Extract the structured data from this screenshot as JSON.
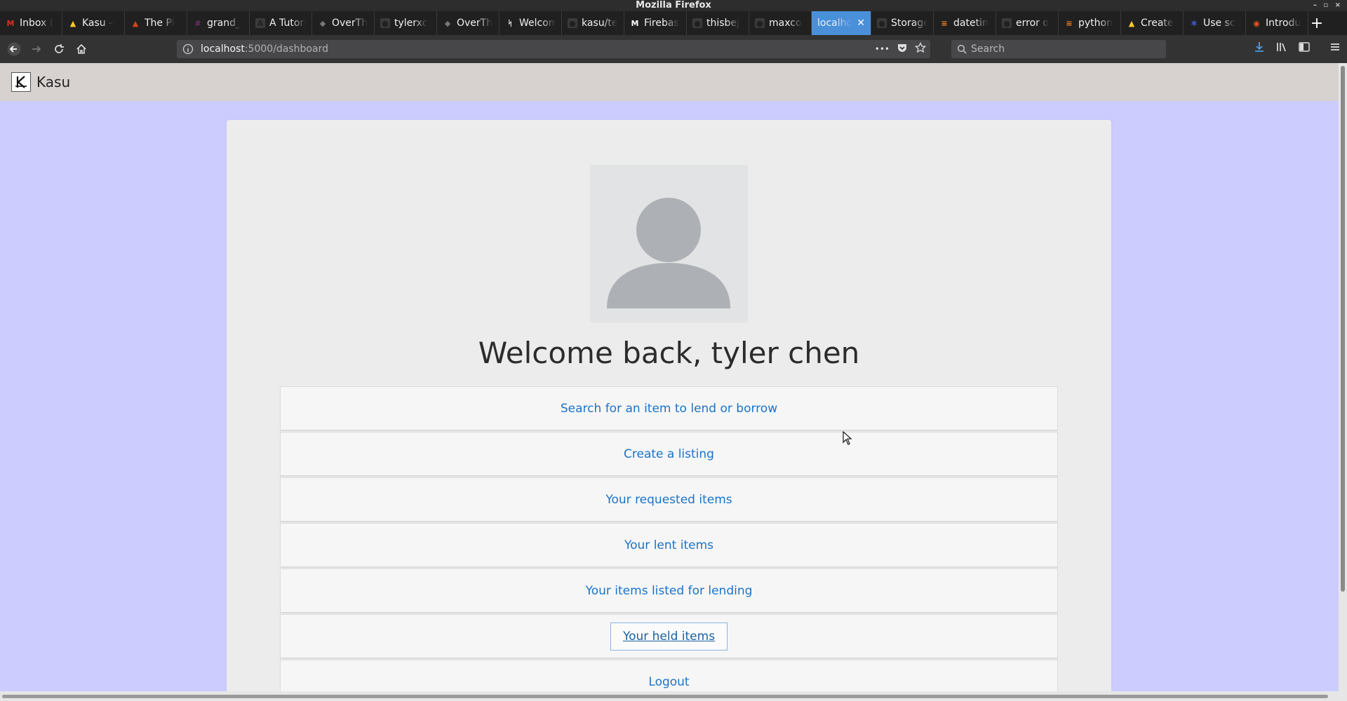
{
  "window": {
    "title": "Mozilla Firefox",
    "controls": "– ▫ ×"
  },
  "tabs": [
    {
      "label": "Inbox (",
      "favicon": "gmail-icon",
      "color": "#d93025"
    },
    {
      "label": "Kasu –",
      "favicon": "firebase-icon",
      "color": "#ffca28"
    },
    {
      "label": "The Pi",
      "favicon": "piedpiper-icon",
      "color": "#d84315"
    },
    {
      "label": "grand_",
      "favicon": "slack-icon",
      "color": "#6f2d6b"
    },
    {
      "label": "A Tutorial",
      "favicon": "text-icon",
      "color": "#202020"
    },
    {
      "label": "OverTh",
      "favicon": "overthewire-icon",
      "color": "#777777"
    },
    {
      "label": "tylerxc",
      "favicon": "github-icon",
      "color": "#202020"
    },
    {
      "label": "OverTh",
      "favicon": "overthewire-icon",
      "color": "#777777"
    },
    {
      "label": "Welcom",
      "favicon": "kasu-icon",
      "color": "#ffffff"
    },
    {
      "label": "kasu/te",
      "favicon": "github-icon",
      "color": "#202020"
    },
    {
      "label": "Firebas",
      "favicon": "medium-icon",
      "color": "#ffffff"
    },
    {
      "label": "thisbej",
      "favicon": "github-icon",
      "color": "#202020"
    },
    {
      "label": "maxco",
      "favicon": "github-icon",
      "color": "#202020"
    },
    {
      "label": "localho",
      "favicon": "none",
      "color": "#4a90d9",
      "active": true
    },
    {
      "label": "Storage",
      "favicon": "github-icon",
      "color": "#202020"
    },
    {
      "label": "datetin",
      "favicon": "stackoverflow-icon",
      "color": "#f48024"
    },
    {
      "label": "error o",
      "favicon": "github-icon",
      "color": "#202020"
    },
    {
      "label": "python",
      "favicon": "stackoverflow-icon",
      "color": "#f48024"
    },
    {
      "label": "Create",
      "favicon": "firebase-icon",
      "color": "#ffca28"
    },
    {
      "label": "Use sc",
      "favicon": "puzzle-icon",
      "color": "#3f51b5"
    },
    {
      "label": "Introdu",
      "favicon": "ubuntu-icon",
      "color": "#e95420"
    }
  ],
  "toolbar": {
    "url_host": "localhost",
    "url_path": ":5000/dashboard",
    "search_placeholder": "Search",
    "more_icon": "•••"
  },
  "app": {
    "brand": "Kasu",
    "welcome": "Welcome back, tyler chen",
    "menu": [
      {
        "label": "Search for an item to lend or borrow"
      },
      {
        "label": "Create a listing"
      },
      {
        "label": "Your requested items"
      },
      {
        "label": "Your lent items"
      },
      {
        "label": "Your items listed for lending"
      },
      {
        "label": "Your held items",
        "focused": true
      },
      {
        "label": "Logout"
      }
    ]
  },
  "colors": {
    "page_bg": "#ccccff",
    "navbar_bg": "#d7d2cf",
    "card_bg": "#ececec",
    "link": "#1a73c6",
    "tab_active": "#4a90d9"
  }
}
